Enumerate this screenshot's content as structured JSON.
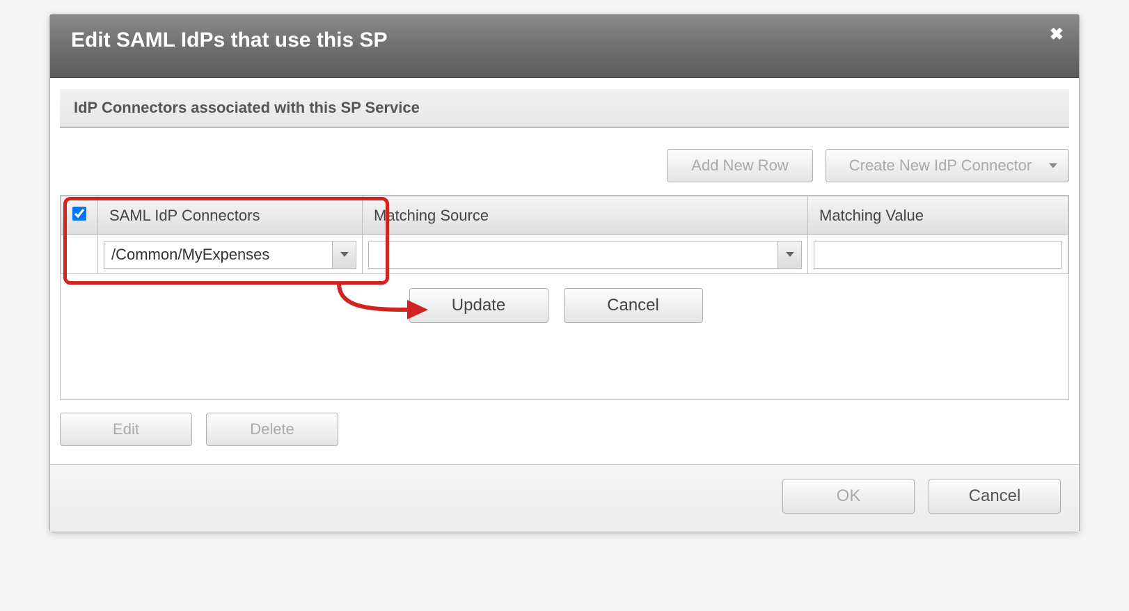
{
  "dialog": {
    "title": "Edit SAML IdPs that use this SP"
  },
  "section": {
    "title": "IdP Connectors associated with this SP Service"
  },
  "toolbar": {
    "add_row": "Add New Row",
    "create_new": "Create New IdP Connector"
  },
  "table": {
    "headers": {
      "connectors": "SAML IdP Connectors",
      "source": "Matching Source",
      "value": "Matching Value"
    },
    "row": {
      "connector_value": "/Common/MyExpenses",
      "source_value": "",
      "value_value": ""
    }
  },
  "inner_buttons": {
    "update": "Update",
    "cancel": "Cancel"
  },
  "actions": {
    "edit": "Edit",
    "delete": "Delete"
  },
  "footer": {
    "ok": "OK",
    "cancel": "Cancel"
  }
}
